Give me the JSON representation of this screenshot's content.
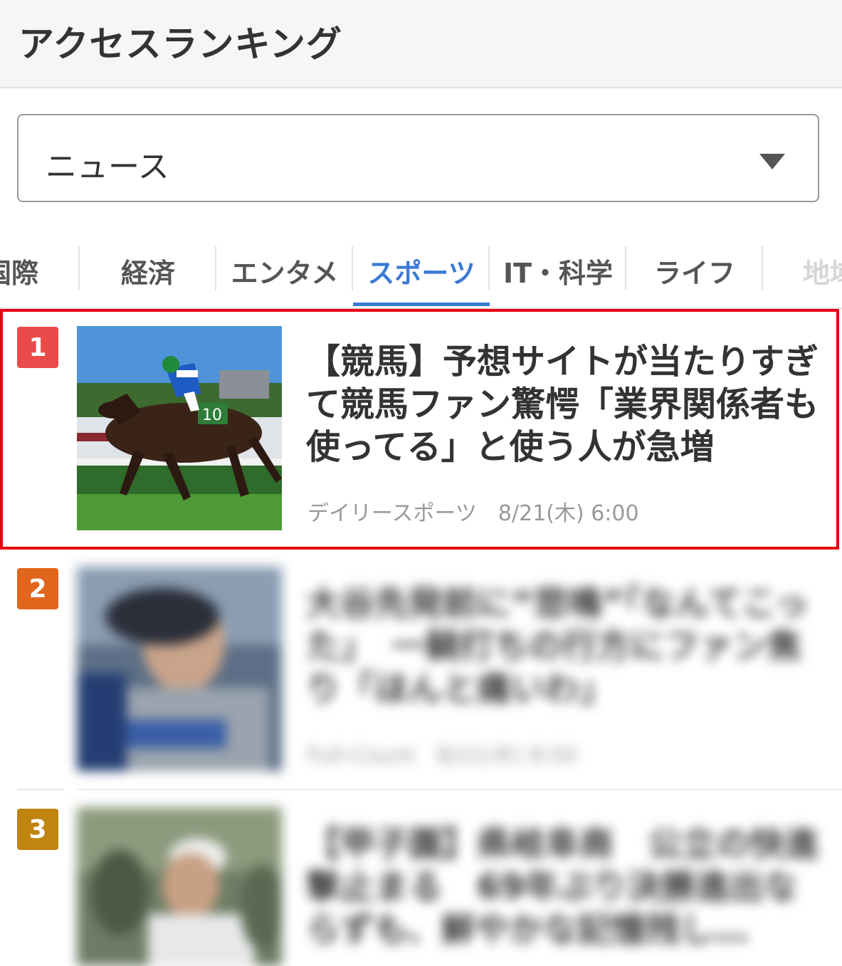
{
  "header": {
    "title": "アクセスランキング"
  },
  "category_select": {
    "value": "ニュース"
  },
  "tabs": [
    {
      "label": "国際",
      "active": false
    },
    {
      "label": "経済",
      "active": false
    },
    {
      "label": "エンタメ",
      "active": false
    },
    {
      "label": "スポーツ",
      "active": true
    },
    {
      "label": "IT・科学",
      "active": false
    },
    {
      "label": "ライフ",
      "active": false
    },
    {
      "label": "地域",
      "active": false
    }
  ],
  "articles": [
    {
      "rank": "1",
      "title": "【競馬】予想サイトが当たりすぎて競馬ファン驚愕「業界関係者も使ってる」と使う人が急増",
      "source": "デイリースポーツ",
      "time": "8/21(木) 6:00"
    },
    {
      "rank": "2",
      "title": "大谷先発前に“悲鳴”「なんてこった」　一騎打ちの行方にファン焦り「ほんと痛いわ」",
      "source": "Full-Count",
      "time": "8/21(木) 8:50"
    },
    {
      "rank": "3",
      "title": "【甲子園】県岐阜商　公立の快進撃止まる　69年ぶり決勝進出ならずも、鮮やかな記憶残し…"
    }
  ],
  "colors": {
    "accent": "#3a7ad6",
    "highlight_border": "#e60012",
    "rank1": "#ea4a4a",
    "rank2": "#e0651d",
    "rank3": "#c08410"
  }
}
